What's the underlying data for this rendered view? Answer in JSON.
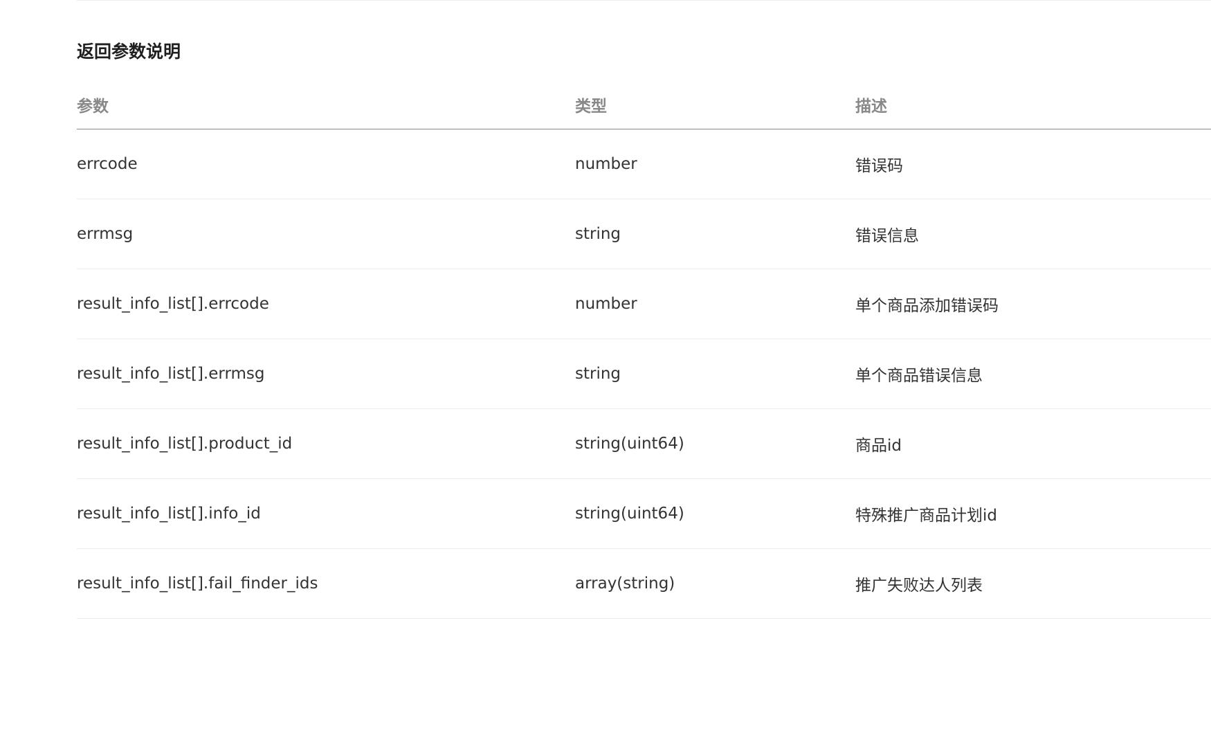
{
  "section": {
    "title": "返回参数说明"
  },
  "table": {
    "headers": {
      "param": "参数",
      "type": "类型",
      "desc": "描述"
    },
    "rows": [
      {
        "param": "errcode",
        "type": "number",
        "desc": "错误码"
      },
      {
        "param": "errmsg",
        "type": "string",
        "desc": "错误信息"
      },
      {
        "param": "result_info_list[].errcode",
        "type": "number",
        "desc": "单个商品添加错误码"
      },
      {
        "param": "result_info_list[].errmsg",
        "type": "string",
        "desc": "单个商品错误信息"
      },
      {
        "param": "result_info_list[].product_id",
        "type": "string(uint64)",
        "desc": "商品id"
      },
      {
        "param": "result_info_list[].info_id",
        "type": "string(uint64)",
        "desc": "特殊推广商品计划id"
      },
      {
        "param": "result_info_list[].fail_finder_ids",
        "type": "array(string)",
        "desc": "推广失败达人列表"
      }
    ]
  }
}
